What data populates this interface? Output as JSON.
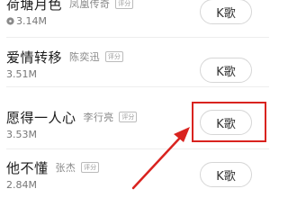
{
  "songs": [
    {
      "title": "荷塘月色",
      "artist": "凤凰传奇",
      "tag": "评分",
      "size": "3.14M",
      "has_disc_icon": true,
      "button_label": "K歌"
    },
    {
      "title": "爱情转移",
      "artist": "陈奕迅",
      "tag": "评分",
      "size": "3.51M",
      "has_disc_icon": false,
      "button_label": "K歌"
    },
    {
      "title": "愿得一人心",
      "artist": "李行亮",
      "tag": "评分",
      "size": "3.53M",
      "has_disc_icon": false,
      "button_label": "K歌"
    },
    {
      "title": "他不懂",
      "artist": "张杰",
      "tag": "评分",
      "size": "2.84M",
      "has_disc_icon": false,
      "button_label": "K歌"
    }
  ],
  "annotation": {
    "highlight_color": "#d9231f",
    "highlighted_song_index": 2,
    "arrow_icon": "arrow-icon"
  },
  "icons": {
    "disc": "disc-icon"
  }
}
